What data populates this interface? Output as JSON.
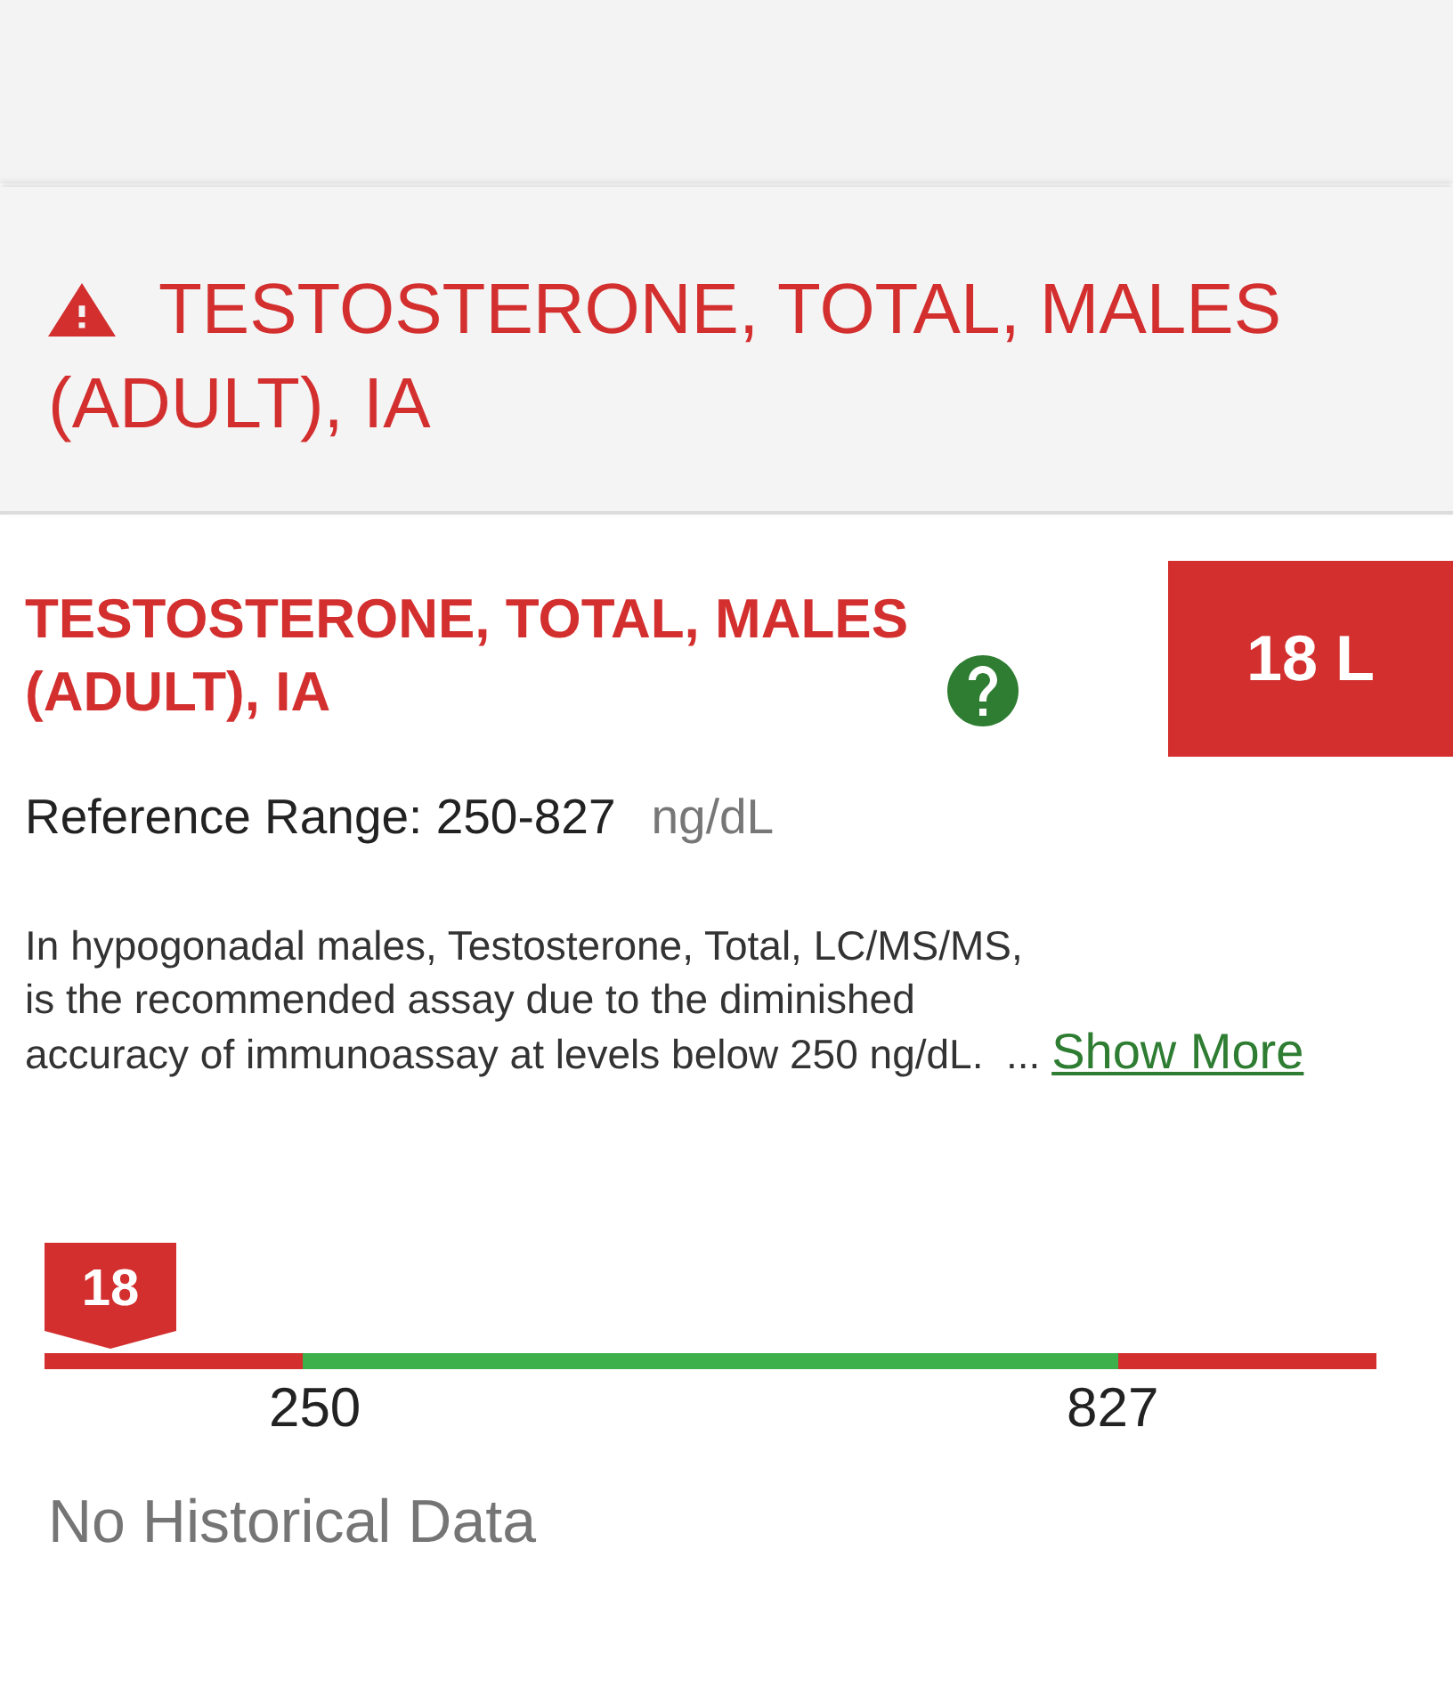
{
  "header": {
    "alert": true,
    "title": "TESTOSTERONE, TOTAL, MALES (ADULT), IA"
  },
  "result": {
    "name": "TESTOSTERONE, TOTAL, MALES (ADULT), IA",
    "abnormal": true,
    "value": "18 L",
    "reference": "Reference Range: 250-827",
    "unit": "ng/dL",
    "note": "In hypogonadal males, Testosterone, Total, LC/MS/MS,\nis the recommended assay due to the diminished\naccuracy of immunoassay at levels below 250 ng/dL.  ...",
    "show_more": "Show More"
  },
  "range": {
    "marker": "18",
    "zones": [
      {
        "kind": "low",
        "current": true
      },
      {
        "kind": "normal",
        "current": false
      },
      {
        "kind": "high",
        "current": false
      }
    ],
    "ticks": [
      "250",
      "827"
    ]
  },
  "history": "No Historical Data"
}
